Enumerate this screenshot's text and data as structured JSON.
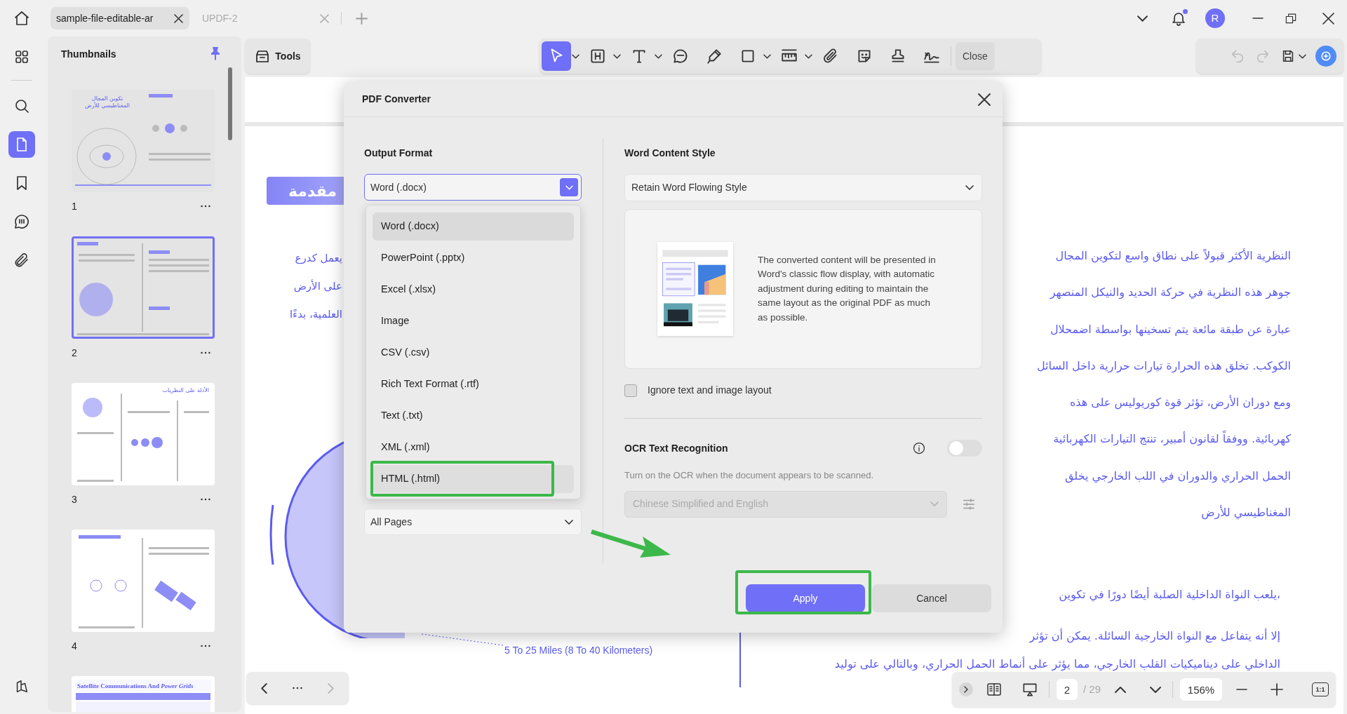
{
  "tab_bar": {
    "first_tab": {
      "label": "sample-file-editable-ar",
      "selected": true
    },
    "second_tab": {
      "label": "UPDF-2",
      "selected": false
    }
  },
  "user": {
    "initial": "R"
  },
  "rail": {
    "items": [
      {
        "kind": "organize",
        "selected": false
      },
      {
        "kind": "search",
        "selected": false
      },
      {
        "kind": "pages",
        "selected": true
      },
      {
        "kind": "bookmark",
        "selected": false
      },
      {
        "kind": "comments",
        "selected": false
      },
      {
        "kind": "attachments",
        "selected": false
      }
    ],
    "bottom": {
      "kind": "layers",
      "selected": false
    }
  },
  "thumbnails": {
    "title": "Thumbnails",
    "pages": [
      {
        "number": "1",
        "selected": false,
        "kind": "diagram",
        "title": "تكوين المجال المغناطيسي للأرض"
      },
      {
        "number": "2",
        "selected": true,
        "kind": "layers"
      },
      {
        "number": "3",
        "selected": false,
        "kind": "planets",
        "title": "الأدلة على النظريات"
      },
      {
        "number": "4",
        "selected": false,
        "kind": "satellite"
      },
      {
        "kind": "table",
        "selected": false,
        "title": "Satellite Communications And *Power Grids*"
      }
    ]
  },
  "toolbar": {
    "tools_label": "Tools",
    "items": [
      {
        "kind": "select",
        "selected": true,
        "has_menu": true
      },
      {
        "kind": "textbox",
        "selected": false,
        "has_menu": true
      },
      {
        "kind": "text",
        "selected": false,
        "has_menu": true
      },
      {
        "kind": "comment",
        "selected": false,
        "has_menu": false
      },
      {
        "kind": "highlight",
        "selected": false,
        "has_menu": false
      },
      {
        "kind": "shape",
        "selected": false,
        "has_menu": true
      },
      {
        "kind": "measure",
        "selected": false,
        "has_menu": true
      },
      {
        "kind": "attach",
        "selected": false,
        "has_menu": false
      },
      {
        "kind": "sticker",
        "selected": false,
        "has_menu": false
      },
      {
        "kind": "stamp",
        "selected": false,
        "has_menu": false
      },
      {
        "kind": "signature",
        "selected": false,
        "has_menu": false
      }
    ],
    "close_label": "Close",
    "right_items": [
      {
        "kind": "undo",
        "disabled": true,
        "has_menu": false
      },
      {
        "kind": "redo",
        "disabled": true,
        "has_menu": false
      },
      {
        "kind": "save",
        "disabled": false,
        "has_menu": true
      },
      {
        "kind": "ai",
        "disabled": false,
        "has_menu": false
      }
    ]
  },
  "document": {
    "heading": "مقدمة",
    "left_lines": [
      "يعمل كدرع",
      "على الأرض",
      "العلمية، بدءًا"
    ],
    "right_lines": [
      "النظرية الأكثر قبولاً على نطاق واسع لتكوين المجال",
      "جوهر هذه النظرية في حركة الحديد والنيكل المنصهر",
      "عبارة عن طبقة مائعة يتم تسخينها بواسطة اضمحلال",
      "الكوكب. تخلق هذه الحرارة تيارات حرارية داخل السائل",
      "ومع دوران الأرض، تؤثر قوة كوريوليس على هذه",
      "كهربائية. ووفقاً لقانون أمبير، تنتج التيارات الكهربائية",
      "الحمل الحراري والدوران في اللب الخارجي يخلق",
      "المغناطيسي للأرض"
    ],
    "lower_lines": [
      "،يلعب النواة الداخلية الصلبة أيضًا دورًا في تكوين",
      "إلا أنه يتفاعل مع النواة الخارجية السائلة. يمكن أن تؤثر",
      "الداخلي على ديناميكيات القلب الخارجي، مما يؤثر على أنماط الحمل الحراري، وبالتالي على توليد"
    ],
    "caption": "5 To 25 Miles (8 To 40 Kilometers)"
  },
  "dialog": {
    "title": "PDF Converter",
    "output_format": {
      "label": "Output Format",
      "value": "Word (.docx)",
      "expanded": true,
      "options": [
        {
          "label": "Word (.docx)",
          "selected": true,
          "hovered": false,
          "callout": false
        },
        {
          "label": "PowerPoint (.pptx)",
          "selected": false,
          "hovered": false,
          "callout": false
        },
        {
          "label": "Excel (.xlsx)",
          "selected": false,
          "hovered": false,
          "callout": false
        },
        {
          "label": "Image",
          "selected": false,
          "hovered": false,
          "callout": false
        },
        {
          "label": "CSV (.csv)",
          "selected": false,
          "hovered": false,
          "callout": false
        },
        {
          "label": "Rich Text Format (.rtf)",
          "selected": false,
          "hovered": false,
          "callout": false
        },
        {
          "label": "Text (.txt)",
          "selected": false,
          "hovered": false,
          "callout": false
        },
        {
          "label": "XML (.xml)",
          "selected": false,
          "hovered": false,
          "callout": false
        },
        {
          "label": "HTML (.html)",
          "selected": false,
          "hovered": true,
          "callout": true
        }
      ]
    },
    "page_range": {
      "value": "All Pages"
    },
    "content_style": {
      "label": "Word Content Style",
      "value": "Retain Word Flowing Style",
      "description": "The converted content will be presented in Word's classic flow display, with automatic adjustment during editing to maintain the same layout as the original PDF as much as possible."
    },
    "ignore_layout": {
      "label": "Ignore text and image layout",
      "checked": false
    },
    "ocr": {
      "label": "OCR Text Recognition",
      "on": false,
      "hint": "Turn on the OCR when the document appears to be scanned.",
      "language": "Chinese Simplified and English",
      "disabled": true
    },
    "apply_button": {
      "label": "Apply",
      "callout": true
    },
    "cancel_button": {
      "label": "Cancel"
    }
  },
  "bottom_bar": {
    "page": "2",
    "total": "/ 29",
    "zoom": "156%",
    "fit_label": "1:1"
  }
}
